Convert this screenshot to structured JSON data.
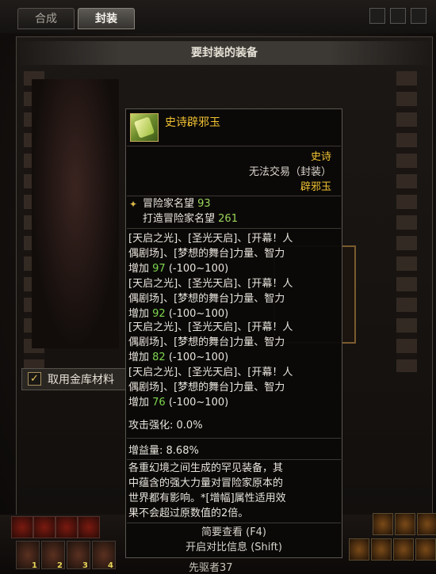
{
  "tabs": [
    {
      "label": "合成",
      "active": false
    },
    {
      "label": "封装",
      "active": true
    }
  ],
  "panel": {
    "title": "要封装的装备"
  },
  "checkbox": {
    "label": "取用金库材料",
    "checked": true
  },
  "character": {
    "name": "先驱者37"
  },
  "slots": [
    "1",
    "2",
    "3",
    "4"
  ],
  "slot_counts": [
    "30",
    "",
    "",
    "83"
  ],
  "tooltip": {
    "item_name": "史诗辟邪玉",
    "rarity": "史诗",
    "tradable": "无法交易（封装）",
    "item_type": "辟邪玉",
    "reputation_label": "冒险家名望",
    "reputation_value": "93",
    "forge_reputation_label": "打造冒险家名望",
    "forge_reputation_value": "261",
    "options": [
      {
        "line1": "[天启之光]、[圣光天启]、[开幕！人",
        "line2": "偶剧场]、[梦想的舞台]力量、智力",
        "prefix": "增加",
        "value": "97",
        "range": "(-100~100)"
      },
      {
        "line1": "[天启之光]、[圣光天启]、[开幕！人",
        "line2": "偶剧场]、[梦想的舞台]力量、智力",
        "prefix": "增加",
        "value": "92",
        "range": "(-100~100)"
      },
      {
        "line1": "[天启之光]、[圣光天启]、[开幕！人",
        "line2": "偶剧场]、[梦想的舞台]力量、智力",
        "prefix": "增加",
        "value": "82",
        "range": "(-100~100)"
      },
      {
        "line1": "[天启之光]、[圣光天启]、[开幕！人",
        "line2": "偶剧场]、[梦想的舞台]力量、智力",
        "prefix": "增加",
        "value": "76",
        "range": "(-100~100)"
      }
    ],
    "attack_label": "攻击强化:",
    "attack_value": "0.0%",
    "gain_label": "增益量:",
    "gain_value": "8.68%",
    "description": [
      "各重幻境之间生成的罕见装备，其",
      "中蕴含的强大力量对冒险家原本的",
      "世界都有影响。*[增幅]属性适用效",
      "果不会超过原数值的2倍。"
    ],
    "brief_view": "简要查看 (F4)",
    "compare_info": "开启对比信息 (Shift)"
  },
  "colors": {
    "epic": "#f1c232",
    "option_value": "#7fd54e",
    "background": "#0b0908"
  }
}
